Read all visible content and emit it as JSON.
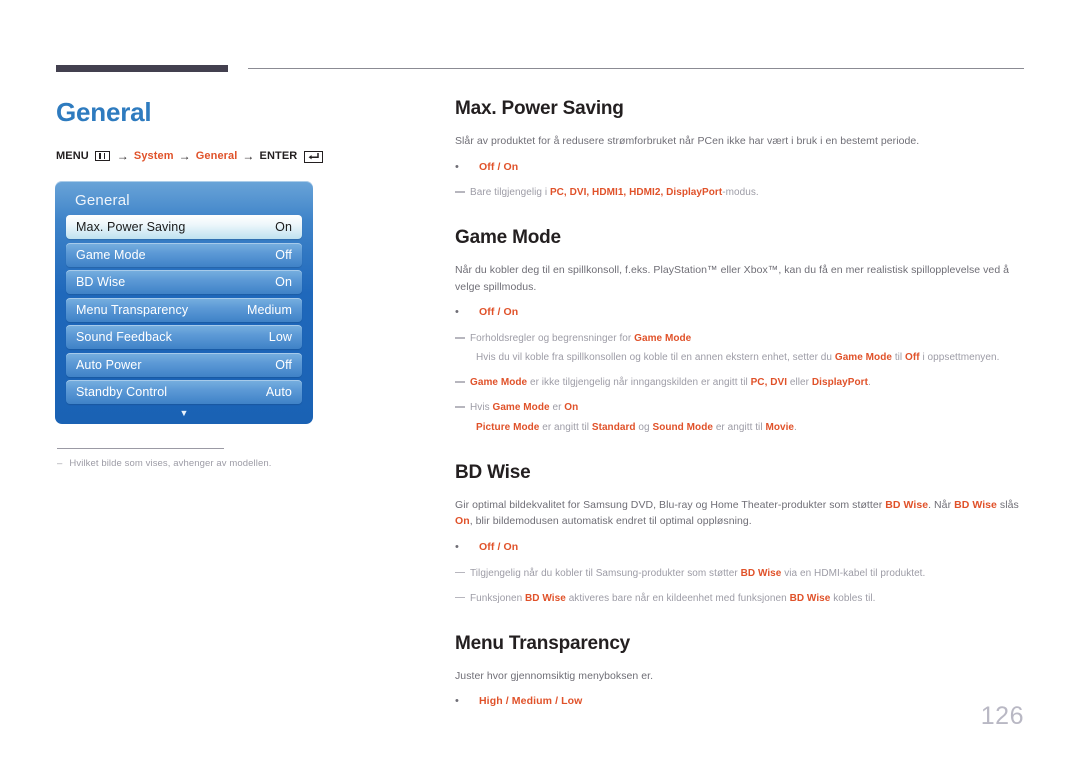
{
  "header": {
    "chapter_title": "General",
    "page_number": "126"
  },
  "breadcrumb": {
    "menu_label": "MENU",
    "menu_icon": "menu-bars-icon",
    "arrow": "→",
    "step1": "System",
    "step2": "General",
    "enter_label": "ENTER",
    "enter_icon": "enter-key-icon"
  },
  "osd": {
    "title": "General",
    "down_arrow_icon": "chevron-down-icon",
    "rows": [
      {
        "label": "Max. Power Saving",
        "value": "On",
        "selected": true
      },
      {
        "label": "Game Mode",
        "value": "Off",
        "selected": false
      },
      {
        "label": "BD Wise",
        "value": "On",
        "selected": false
      },
      {
        "label": "Menu Transparency",
        "value": "Medium",
        "selected": false
      },
      {
        "label": "Sound Feedback",
        "value": "Low",
        "selected": false
      },
      {
        "label": "Auto Power",
        "value": "Off",
        "selected": false
      },
      {
        "label": "Standby Control",
        "value": "Auto",
        "selected": false
      }
    ]
  },
  "left_note": {
    "dash": "–",
    "text": "Hvilket bilde som vises, avhenger av modellen."
  },
  "sections": {
    "max_power_saving": {
      "title": "Max. Power Saving",
      "body": "Slår av produktet for å redusere strømforbruket når PCen ikke har vært i bruk i en bestemt periode.",
      "options": "Off / On",
      "note1_a": "Bare tilgjengelig i ",
      "note1_b": "PC, DVI, HDMI1, HDMI2, DisplayPort",
      "note1_c": "-modus."
    },
    "game_mode": {
      "title": "Game Mode",
      "body": "Når du kobler deg til en spillkonsoll, f.eks. PlayStation™ eller Xbox™, kan du få en mer realistisk spillopplevelse ved å velge spillmodus.",
      "options": "Off / On",
      "note1_a": "Forholdsregler og begrensninger for ",
      "note1_b": "Game Mode",
      "note1_sub_a": "Hvis du  vil koble fra spillkonsollen og koble til en annen ekstern enhet, setter du ",
      "note1_sub_b": "Game Mode",
      "note1_sub_c": " til ",
      "note1_sub_d": "Off",
      "note1_sub_e": " i oppsettmenyen.",
      "note2_a": "Game Mode",
      "note2_b": " er ikke tilgjengelig når inngangskilden er angitt til ",
      "note2_c": "PC, DVI",
      "note2_d": " eller ",
      "note2_e": "DisplayPort",
      "note2_f": ".",
      "note3_a": "Hvis ",
      "note3_b": "Game Mode",
      "note3_c": " er ",
      "note3_d": "On",
      "note3_sub_a": "Picture Mode",
      "note3_sub_b": " er angitt til ",
      "note3_sub_c": "Standard",
      "note3_sub_d": " og ",
      "note3_sub_e": "Sound Mode",
      "note3_sub_f": " er angitt til ",
      "note3_sub_g": "Movie",
      "note3_sub_h": "."
    },
    "bd_wise": {
      "title": "BD Wise",
      "body_a": "Gir optimal bildekvalitet for Samsung DVD, Blu-ray og Home Theater-produkter som støtter ",
      "body_b": "BD Wise",
      "body_c": ". Når ",
      "body_d": "BD Wise",
      "body_e": " slås ",
      "body_f": "On",
      "body_g": ", blir bildemodusen automatisk endret til optimal oppløsning.",
      "options": "Off / On",
      "note1_a": "Tilgjengelig når du kobler til Samsung-produkter som støtter ",
      "note1_b": "BD Wise",
      "note1_c": " via en HDMI-kabel til produktet.",
      "note2_a": "Funksjonen ",
      "note2_b": "BD Wise",
      "note2_c": " aktiveres bare når en kildeenhet med funksjonen ",
      "note2_d": "BD Wise",
      "note2_e": " kobles til."
    },
    "menu_transparency": {
      "title": "Menu Transparency",
      "body": "Juster hvor gjennomsiktig menyboksen er.",
      "options": "High / Medium / Low"
    }
  },
  "colors": {
    "accent_orange": "#e0522a",
    "chapter_blue": "#2e7bbf",
    "body_gray": "#6f6e76",
    "note_gray": "#9d9ca6",
    "header_bar": "#43404f"
  }
}
